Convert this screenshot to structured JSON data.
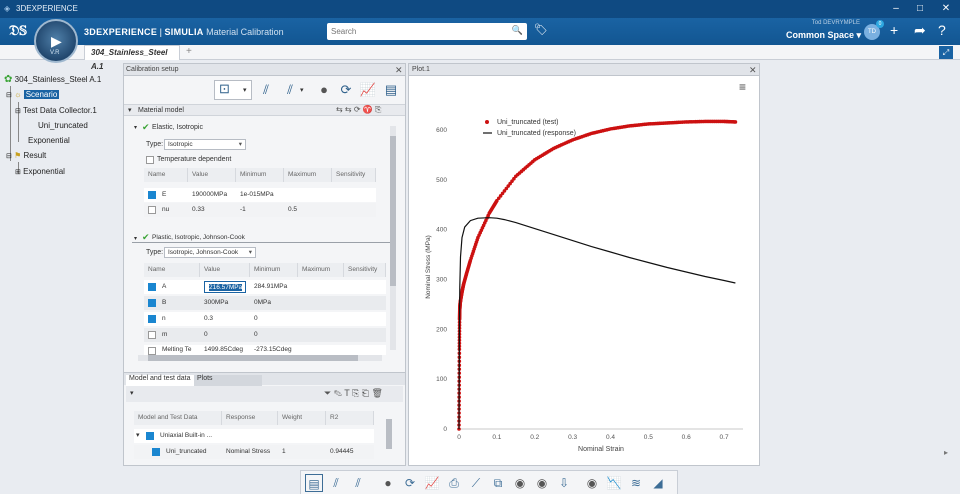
{
  "window": {
    "title": "3DEXPERIENCE"
  },
  "brand": {
    "platform": "3DEXPERIENCE",
    "separator": " | ",
    "product": "SIMULIA",
    "app": "Material Calibration",
    "compass_version": "V.R"
  },
  "search": {
    "placeholder": "Search"
  },
  "user": {
    "name": "Tod DEVRYMPLE",
    "space": "Common Space",
    "initials": "TD",
    "badge": "0"
  },
  "tab": {
    "label": "304_Stainless_Steel A.1",
    "add": "+"
  },
  "tree": {
    "root": "304_Stainless_Steel A.1",
    "items": [
      "Scenario",
      "Test Data Collector.1",
      "Uni_truncated",
      "Exponential",
      "Result",
      "Exponential"
    ]
  },
  "calibration": {
    "title": "Calibration setup",
    "material_model_label": "Material model",
    "elastic": {
      "title": "Elastic, Isotropic",
      "type_label": "Type:",
      "type_value": "Isotropic",
      "temp_dep": "Temperature dependent",
      "headers": [
        "Name",
        "Value",
        "Minimum",
        "Maximum",
        "Sensitivity"
      ],
      "rows": [
        {
          "name": "E",
          "value": "190000MPa",
          "min": "1e-015MPa",
          "max": "",
          "checked": true
        },
        {
          "name": "nu",
          "value": "0.33",
          "min": "-1",
          "max": "0.5",
          "checked": false
        }
      ]
    },
    "plastic": {
      "title": "Plastic, Isotropic, Johnson-Cook",
      "type_label": "Type:",
      "type_value": "Isotropic, Johnson-Cook",
      "headers": [
        "Name",
        "Value",
        "Minimum",
        "Maximum",
        "Sensitivity"
      ],
      "rows": [
        {
          "name": "A",
          "value": "216.57MPa",
          "min": "284.91MPa",
          "checked": true
        },
        {
          "name": "B",
          "value": "300MPa",
          "min": "0MPa",
          "checked": true
        },
        {
          "name": "n",
          "value": "0.3",
          "min": "0",
          "checked": true
        },
        {
          "name": "m",
          "value": "0",
          "min": "0",
          "checked": false
        },
        {
          "name": "Melting Te",
          "value": "1499.85Cdeg",
          "min": "-273.15Cdeg",
          "checked": false
        }
      ]
    },
    "bottom_tabs": [
      "Model and test data",
      "Plots"
    ],
    "bottom_headers": [
      "Model and Test Data",
      "Response",
      "Weight",
      "R2"
    ],
    "bottom_rows": [
      {
        "name": "Uniaxial Built-in ...",
        "response": "",
        "weight": "",
        "r2": ""
      },
      {
        "name": "Uni_truncated",
        "response": "Nominal Stress",
        "weight": "1",
        "r2": "0.94445"
      }
    ]
  },
  "plot": {
    "title": "Plot.1"
  },
  "chart_data": {
    "type": "line",
    "xlabel": "Nominal Strain",
    "ylabel": "Nominal Stress (MPa)",
    "xlim": [
      0,
      0.75
    ],
    "ylim": [
      0,
      650
    ],
    "xticks": [
      "0",
      "0.1",
      "0.2",
      "0.3",
      "0.4",
      "0.5",
      "0.6",
      "0.7"
    ],
    "yticks": [
      "0",
      "100",
      "200",
      "300",
      "400",
      "500",
      "600"
    ],
    "legend_position": "top-left",
    "series": [
      {
        "name": "Uni_truncated (test)",
        "style": "markers",
        "color": "#cc1111",
        "x": [
          0,
          0.0005,
          0.001,
          0.0015,
          0.002,
          0.003,
          0.005,
          0.008,
          0.012,
          0.02,
          0.03,
          0.05,
          0.08,
          0.1,
          0.15,
          0.2,
          0.25,
          0.3,
          0.35,
          0.4,
          0.45,
          0.5,
          0.55,
          0.6,
          0.65,
          0.7,
          0.73
        ],
        "y": [
          0,
          80,
          160,
          220,
          240,
          252,
          262,
          275,
          290,
          312,
          338,
          384,
          433,
          458,
          507,
          540,
          563,
          580,
          593,
          602,
          608,
          612,
          614,
          616,
          617,
          617,
          616
        ]
      },
      {
        "name": "Uni_truncated (response)",
        "style": "line",
        "color": "#111111",
        "x": [
          0,
          0.0005,
          0.001,
          0.0015,
          0.002,
          0.004,
          0.008,
          0.015,
          0.03,
          0.05,
          0.08,
          0.1,
          0.12,
          0.15,
          0.2,
          0.25,
          0.3,
          0.35,
          0.4,
          0.45,
          0.5,
          0.55,
          0.6,
          0.65,
          0.7,
          0.73
        ],
        "y": [
          0,
          95,
          190,
          240,
          285,
          345,
          384,
          405,
          418,
          423,
          424,
          423,
          420,
          414,
          402,
          390,
          378,
          366,
          355,
          344,
          334,
          324,
          315,
          306,
          298,
          293
        ]
      }
    ]
  }
}
